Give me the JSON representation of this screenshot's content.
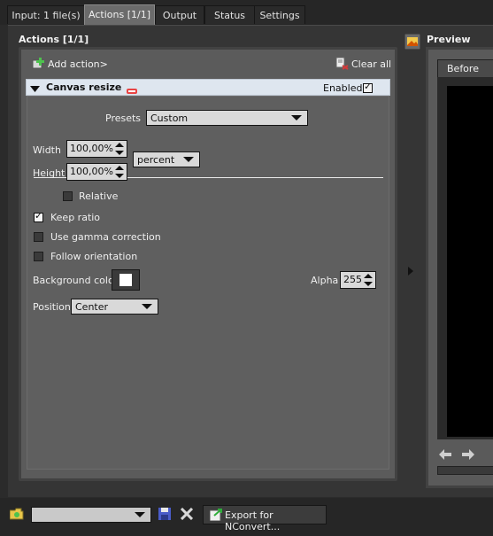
{
  "tabs": [
    {
      "label": "Input: 1 file(s)"
    },
    {
      "label": "Actions [1/1]"
    },
    {
      "label": "Output"
    },
    {
      "label": "Status"
    },
    {
      "label": "Settings"
    }
  ],
  "actions": {
    "title": "Actions [1/1]",
    "add_action": "Add action>",
    "clear_all": "Clear all",
    "action": {
      "name": "Canvas resize",
      "enabled_label": "Enabled",
      "enabled": true,
      "presets_label": "Presets",
      "presets_value": "Custom",
      "width_label": "Width",
      "width_value": "100,00%",
      "height_label": "Height",
      "height_value": "100,00%",
      "unit_value": "percent",
      "relative_label": "Relative",
      "relative": false,
      "keep_ratio_label": "Keep ratio",
      "keep_ratio": true,
      "gamma_label": "Use gamma correction",
      "gamma": false,
      "follow_orientation_label": "Follow orientation",
      "follow_orientation": false,
      "bg_color_label": "Background color",
      "bg_color": "#ffffff",
      "alpha_label": "Alpha",
      "alpha_value": "255",
      "position_label": "Position",
      "position_value": "Center"
    }
  },
  "preview": {
    "title": "Preview",
    "tab_before": "Before"
  },
  "bottom": {
    "preset_select_value": "",
    "export_label": "Export for NConvert..."
  }
}
